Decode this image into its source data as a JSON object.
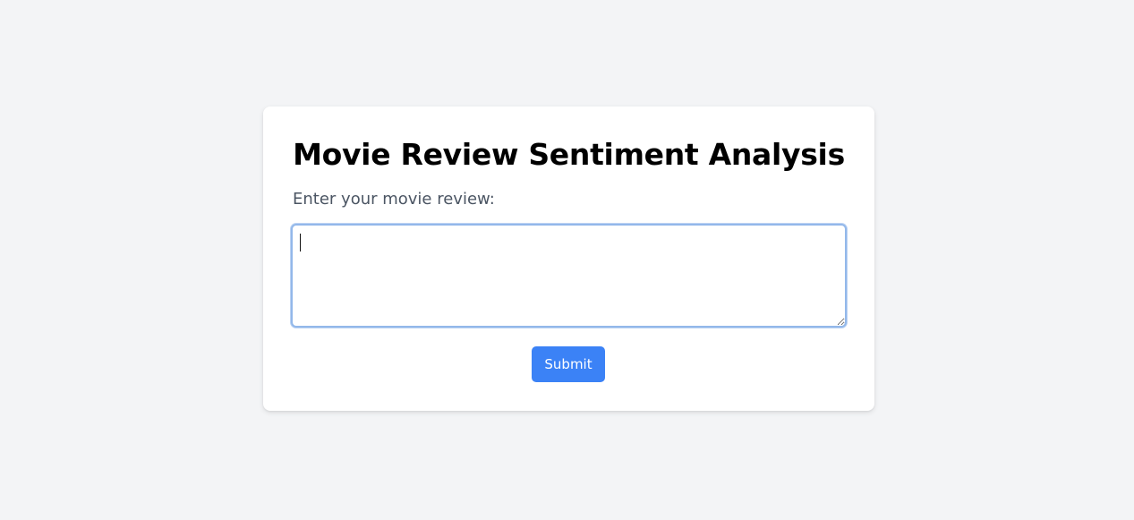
{
  "page": {
    "title": "Movie Review Sentiment Analysis",
    "review_label": "Enter your movie review:",
    "review_value": "",
    "submit_label": "Submit"
  },
  "colors": {
    "background": "#f3f4f6",
    "card": "#ffffff",
    "accent": "#3b82f6",
    "input_focus_border": "#93b8ea"
  }
}
